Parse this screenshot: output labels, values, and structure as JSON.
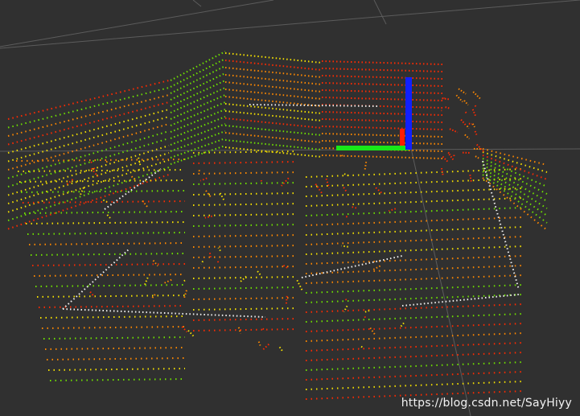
{
  "watermark": {
    "text": "https://blog.csdn.net/SayHiyy"
  },
  "colors": {
    "background": "#303030",
    "grid": "#5c5c5c",
    "axis_x": "#ff1e00",
    "axis_y": "#18e818",
    "axis_z": "#1020ff",
    "cloud_red": "#ff2a00",
    "cloud_orange": "#ff8800",
    "cloud_yellow": "#f4e000",
    "cloud_green": "#6ee000",
    "cloud_white": "#f0f0f0"
  },
  "icons": [
    "axes-marker-icon"
  ]
}
